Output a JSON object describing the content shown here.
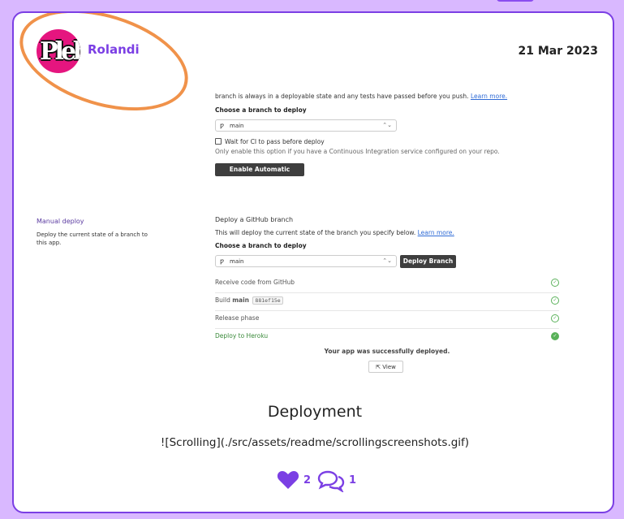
{
  "post": {
    "author": "Rolandi",
    "avatar_text": "Pleb",
    "date": "21 Mar 2023",
    "section_title": "Deployment",
    "markdown_line": "![Scrolling](./src/assets/readme/scrollingscreenshots.gif)",
    "likes": "2",
    "comments": "1"
  },
  "screenshot": {
    "auto_deploy": {
      "intro_text": "branch is always in a deployable state and any tests have passed before you push.",
      "learn_more": "Learn more.",
      "choose_label": "Choose a branch to deploy",
      "branch_value": "main",
      "wait_ci_label": "Wait for CI to pass before deploy",
      "wait_ci_help": "Only enable this option if you have a Continuous Integration service configured on your repo.",
      "enable_button": "Enable Automatic Deploys"
    },
    "manual_deploy": {
      "title": "Manual deploy",
      "description": "Deploy the current state of a branch to this app.",
      "heading": "Deploy a GitHub branch",
      "intro_text": "This will deploy the current state of the branch you specify below.",
      "learn_more": "Learn more.",
      "choose_label": "Choose a branch to deploy",
      "branch_value": "main",
      "deploy_button": "Deploy Branch",
      "steps": [
        {
          "label": "Receive code from GitHub"
        },
        {
          "label": "Build",
          "bold": "main",
          "code": "881ef15e"
        },
        {
          "label": "Release phase"
        },
        {
          "label": "Deploy to Heroku"
        }
      ],
      "success_message": "Your app was successfully deployed.",
      "view_button": "View"
    }
  },
  "colors": {
    "accent": "#7b3fe4",
    "background": "#d9b8ff",
    "annotation": "#f0924a",
    "avatar": "#e5157f",
    "success": "#59b159"
  },
  "icons": [
    "heart-icon",
    "comment-icon",
    "branch-icon",
    "chevron-updown-icon",
    "check-circle-icon",
    "external-link-icon"
  ]
}
